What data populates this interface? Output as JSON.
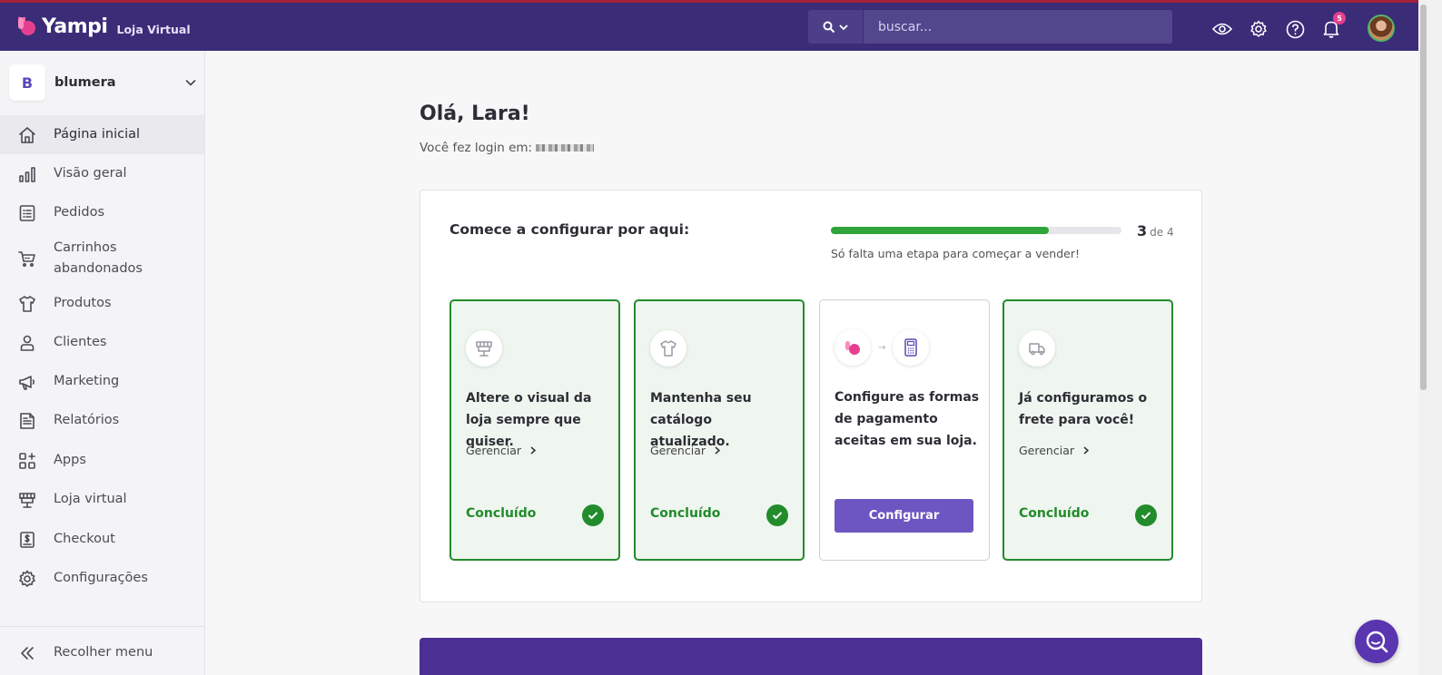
{
  "header": {
    "brand": "Yampi",
    "brand_sub": "Loja Virtual",
    "search_placeholder": "buscar...",
    "notification_count": "5",
    "icons": [
      "eye-icon",
      "gear-icon",
      "help-icon",
      "bell-icon"
    ]
  },
  "sidebar": {
    "store_letter": "B",
    "store_name": "blumera",
    "items": [
      {
        "label": "Página inicial",
        "icon": "home-icon",
        "active": true
      },
      {
        "label": "Visão geral",
        "icon": "chart-icon"
      },
      {
        "label": "Pedidos",
        "icon": "list-icon"
      },
      {
        "label": "Carrinhos abandonados",
        "icon": "cart-icon"
      },
      {
        "label": "Produtos",
        "icon": "shirt-icon"
      },
      {
        "label": "Clientes",
        "icon": "user-icon"
      },
      {
        "label": "Marketing",
        "icon": "megaphone-icon"
      },
      {
        "label": "Relatórios",
        "icon": "report-icon"
      },
      {
        "label": "Apps",
        "icon": "apps-icon"
      },
      {
        "label": "Loja virtual",
        "icon": "store-icon"
      },
      {
        "label": "Checkout",
        "icon": "checkout-icon"
      },
      {
        "label": "Configurações",
        "icon": "settings-icon"
      }
    ],
    "collapse_label": "Recolher menu"
  },
  "main": {
    "greeting": "Olá, Lara!",
    "login_text": "Você fez login em:",
    "setup": {
      "title": "Comece a configurar por aqui:",
      "progress_done": "3",
      "progress_total_text": "de 4",
      "progress_fraction": 0.75,
      "hint": "Só falta uma etapa para começar a vender!",
      "steps": [
        {
          "text": "Altere o visual da loja sempre que quiser.",
          "link": "Gerenciar",
          "status": "Concluído",
          "icon": "storefront-icon"
        },
        {
          "text": "Mantenha seu catálogo atualizado.",
          "link": "Gerenciar",
          "status": "Concluído",
          "icon": "shirt-icon"
        },
        {
          "text": "Configure as formas de pagamento aceitas em sua loja.",
          "button": "Configurar",
          "icon": "payment-terminal-icon"
        },
        {
          "text": "Já configuramos o frete para você!",
          "link": "Gerenciar",
          "status": "Concluído",
          "icon": "truck-icon"
        }
      ]
    }
  },
  "colors": {
    "topbar": "#3b2c78",
    "success": "#228b2b",
    "progress": "#2ea43a",
    "primary_button": "#6d56c1",
    "brand_pink": "#e5408f"
  }
}
